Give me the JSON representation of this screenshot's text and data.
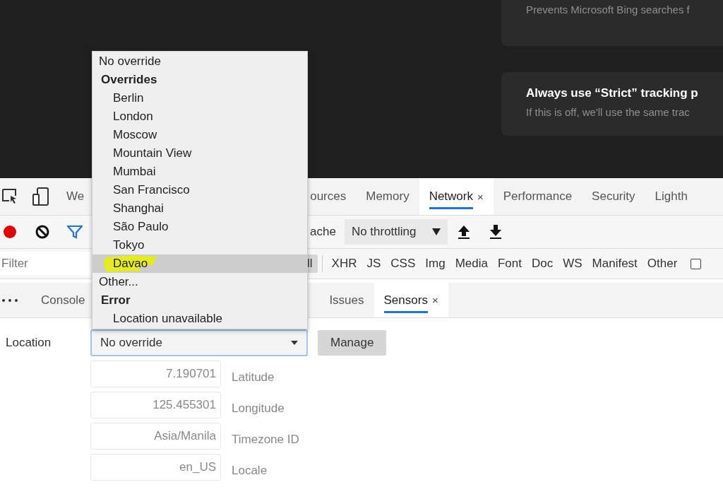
{
  "settings_page": {
    "cards": [
      {
        "description": "Prevents Microsoft Bing searches f"
      },
      {
        "title": "Always use “Strict” tracking p",
        "description": "If this is off, we'll use the same trac"
      }
    ]
  },
  "devtools": {
    "main_tabs": [
      {
        "label": "We",
        "selected": false
      },
      {
        "label": "ources",
        "selected": false
      },
      {
        "label": "Memory",
        "selected": false
      },
      {
        "label": "Network",
        "selected": true,
        "close": "×"
      },
      {
        "label": "Performance",
        "selected": false
      },
      {
        "label": "Security",
        "selected": false
      },
      {
        "label": "Lighth",
        "selected": false
      }
    ],
    "network_toolbar": {
      "recording": true,
      "cache_label": "ache",
      "throttling": "No throttling"
    },
    "filter_bar": {
      "placeholder": "Filter",
      "types": [
        {
          "label": "ll",
          "selected": true
        },
        {
          "label": "XHR",
          "selected": false
        },
        {
          "label": "JS",
          "selected": false
        },
        {
          "label": "CSS",
          "selected": false
        },
        {
          "label": "Img",
          "selected": false
        },
        {
          "label": "Media",
          "selected": false
        },
        {
          "label": "Font",
          "selected": false
        },
        {
          "label": "Doc",
          "selected": false
        },
        {
          "label": "WS",
          "selected": false
        },
        {
          "label": "Manifest",
          "selected": false
        },
        {
          "label": "Other",
          "selected": false
        }
      ],
      "checkbox": {
        "checked": false
      }
    },
    "drawer_tabs": [
      {
        "label": "Console",
        "selected": false
      },
      {
        "label": "Issues",
        "selected": false
      },
      {
        "label": "Sensors",
        "selected": true,
        "close": "×"
      }
    ],
    "sensors": {
      "location_label": "Location",
      "location_value": "No override",
      "manage_button": "Manage",
      "fields": [
        {
          "value": "7.190701",
          "label": "Latitude"
        },
        {
          "value": "125.455301",
          "label": "Longitude"
        },
        {
          "value": "Asia/Manila",
          "label": "Timezone ID"
        },
        {
          "value": "en_US",
          "label": "Locale"
        }
      ]
    },
    "location_menu": {
      "items": [
        {
          "kind": "option",
          "label": "No override",
          "selected": false,
          "marked": false
        },
        {
          "kind": "group",
          "label": "Overrides",
          "children": [
            {
              "label": "Berlin",
              "selected": false,
              "marked": false
            },
            {
              "label": "London",
              "selected": false,
              "marked": false
            },
            {
              "label": "Moscow",
              "selected": false,
              "marked": false
            },
            {
              "label": "Mountain View",
              "selected": false,
              "marked": false
            },
            {
              "label": "Mumbai",
              "selected": false,
              "marked": false
            },
            {
              "label": "San Francisco",
              "selected": false,
              "marked": false
            },
            {
              "label": "Shanghai",
              "selected": false,
              "marked": false
            },
            {
              "label": "São Paulo",
              "selected": false,
              "marked": false
            },
            {
              "label": "Tokyo",
              "selected": false,
              "marked": false
            },
            {
              "label": "Davao",
              "selected": true,
              "marked": true
            }
          ]
        },
        {
          "kind": "option",
          "label": "Other...",
          "selected": false,
          "marked": false
        },
        {
          "kind": "group",
          "label": "Error",
          "children": [
            {
              "label": "Location unavailable",
              "selected": false,
              "marked": false
            }
          ]
        }
      ]
    }
  }
}
